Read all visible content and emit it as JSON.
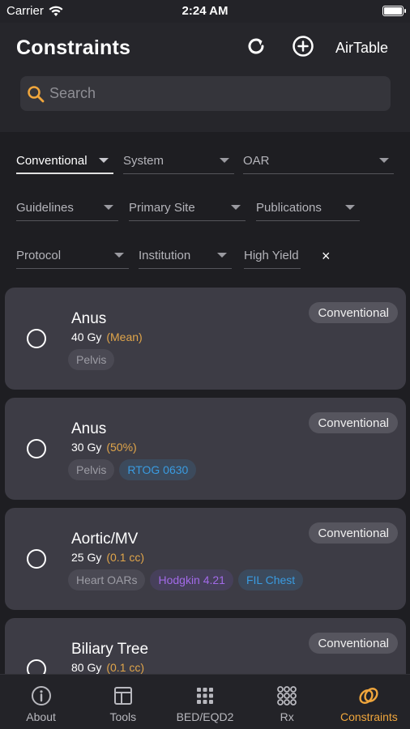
{
  "status": {
    "carrier": "Carrier",
    "time": "2:24 AM"
  },
  "header": {
    "title": "Constraints",
    "airtable": "AirTable"
  },
  "search": {
    "placeholder": "Search"
  },
  "filters": {
    "conventional": "Conventional",
    "system": "System",
    "oar": "OAR",
    "guidelines": "Guidelines",
    "primary_site": "Primary Site",
    "publications": "Publications",
    "protocol": "Protocol",
    "institution": "Institution",
    "high_yield": "High Yield",
    "clear": "×"
  },
  "cards": [
    {
      "name": "Anus",
      "dose": "40 Gy",
      "qualifier": "(Mean)",
      "badge": "Conventional",
      "tags": [
        "Pelvis"
      ]
    },
    {
      "name": "Anus",
      "dose": "30 Gy",
      "qualifier": "(50%)",
      "badge": "Conventional",
      "tags": [
        "Pelvis",
        "RTOG 0630"
      ]
    },
    {
      "name": "Aortic/MV",
      "dose": "25 Gy",
      "qualifier": "(0.1 cc)",
      "badge": "Conventional",
      "tags": [
        "Heart OARs",
        "Hodgkin 4.21",
        "FIL Chest"
      ]
    },
    {
      "name": "Biliary Tree",
      "dose": "80 Gy",
      "qualifier": "(0.1 cc)",
      "badge": "Conventional",
      "tags": []
    }
  ],
  "tabs": [
    {
      "label": "About",
      "icon": "info-icon"
    },
    {
      "label": "Tools",
      "icon": "tools-icon"
    },
    {
      "label": "BED/EQD2",
      "icon": "grid-icon"
    },
    {
      "label": "Rx",
      "icon": "dots-grid-icon"
    },
    {
      "label": "Constraints",
      "icon": "rings-icon"
    }
  ],
  "colors": {
    "accent": "#f0a63c",
    "card": "#3d3c45",
    "background": "#1e1e22",
    "tag_blue": "#3a9be0",
    "tag_purple": "#a26ae8",
    "qualifier": "#e0a54a"
  }
}
